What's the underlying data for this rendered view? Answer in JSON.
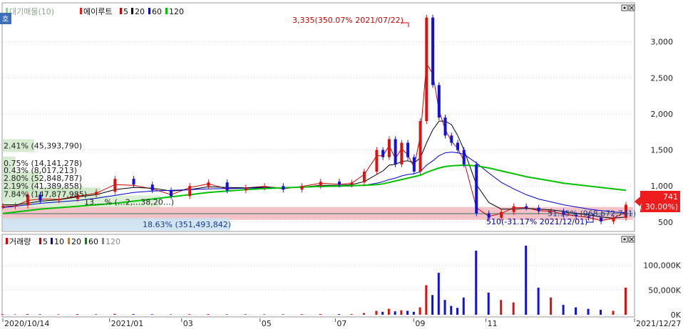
{
  "chart_data": [
    {
      "type": "candlestick",
      "legend": [
        {
          "label": "대기매물(10)",
          "color": "#8fd48f"
        },
        {
          "label": "에이루트",
          "color": "#e02020"
        },
        {
          "label": "5",
          "color": "#cc0000"
        },
        {
          "label": "20",
          "color": "#000000"
        },
        {
          "label": "60",
          "color": "#0000cc"
        },
        {
          "label": "120",
          "color": "#00c000"
        }
      ],
      "y_ticks": [
        "500",
        "1,000",
        "1,500",
        "2,000",
        "2,500",
        "3,000"
      ],
      "y_tick_values": [
        500,
        1000,
        1500,
        2000,
        2500,
        3000
      ],
      "ylim": [
        400,
        3500
      ],
      "x_ticks": [
        "2020/10/14",
        "2021/01",
        "03",
        "05",
        "07",
        "09",
        "11",
        "2021/12/27"
      ],
      "high_annotation": "3,335(350.07% 2021/07/22)",
      "low_annotation": "510(-31.17% 2021/12/01)",
      "current_price": "741",
      "current_change": "( 30.00%)",
      "volume_profile": [
        {
          "label": "2.41% (45,393,790)",
          "price": 1560
        },
        {
          "label": "0.75% (14,141,278)",
          "price": 1320
        },
        {
          "label": "0.43% (8,017,213)",
          "price": 1220
        },
        {
          "label": "2.80% (52,848,787)",
          "price": 1110
        },
        {
          "label": "2.19% (41,389,858)",
          "price": 1000
        },
        {
          "label": "7.84% (147,877,985)",
          "price": 890
        },
        {
          "label": "13.…% (…2,…38,20…)",
          "price": 780
        },
        {
          "label": "51.35% (968,672,741)",
          "price": 620
        },
        {
          "label": "18.63% (351,493,842)",
          "price": 470
        }
      ],
      "series": [
        {
          "name": "price",
          "x": [
            0.0,
            0.02,
            0.04,
            0.06,
            0.09,
            0.12,
            0.15,
            0.18,
            0.21,
            0.24,
            0.27,
            0.3,
            0.33,
            0.36,
            0.39,
            0.42,
            0.45,
            0.48,
            0.51,
            0.54,
            0.56,
            0.58,
            0.6,
            0.61,
            0.62,
            0.63,
            0.64,
            0.65,
            0.66,
            0.67,
            0.68,
            0.69,
            0.7,
            0.71,
            0.72,
            0.73,
            0.74,
            0.76,
            0.78,
            0.8,
            0.82,
            0.84,
            0.86,
            0.88,
            0.9,
            0.92,
            0.94,
            0.96,
            0.98,
            1.0
          ],
          "values": [
            720,
            730,
            880,
            800,
            820,
            880,
            920,
            1100,
            1020,
            940,
            860,
            1000,
            1050,
            940,
            980,
            1000,
            950,
            1000,
            1060,
            1020,
            1050,
            1200,
            1500,
            1400,
            1650,
            1300,
            1600,
            1400,
            1200,
            1900,
            3335,
            2400,
            1950,
            1700,
            1600,
            1500,
            1300,
            620,
            560,
            640,
            720,
            700,
            650,
            650,
            600,
            580,
            560,
            510,
            560,
            741
          ]
        },
        {
          "name": "5",
          "color": "#cc0000",
          "values": [
            720,
            725,
            800,
            820,
            815,
            860,
            900,
            1020,
            1010,
            960,
            880,
            980,
            1030,
            960,
            975,
            995,
            960,
            995,
            1040,
            1025,
            1040,
            1160,
            1420,
            1420,
            1560,
            1380,
            1520,
            1430,
            1260,
            1700,
            2700,
            2550,
            2050,
            1780,
            1620,
            1520,
            1350,
            700,
            580,
            620,
            700,
            700,
            660,
            650,
            610,
            585,
            565,
            520,
            555,
            640
          ]
        },
        {
          "name": "20",
          "color": "#000000",
          "values": [
            740,
            740,
            760,
            790,
            810,
            850,
            880,
            950,
            980,
            970,
            930,
            950,
            990,
            980,
            975,
            985,
            975,
            985,
            1010,
            1010,
            1020,
            1060,
            1160,
            1210,
            1290,
            1300,
            1340,
            1350,
            1320,
            1390,
            1600,
            1780,
            1900,
            1900,
            1850,
            1700,
            1500,
            1020,
            770,
            680,
            680,
            690,
            680,
            670,
            650,
            620,
            600,
            570,
            555,
            570
          ]
        },
        {
          "name": "60",
          "color": "#0000cc",
          "values": [
            700,
            720,
            740,
            760,
            780,
            800,
            830,
            870,
            910,
            930,
            940,
            950,
            960,
            965,
            970,
            975,
            978,
            982,
            990,
            995,
            1000,
            1010,
            1040,
            1060,
            1090,
            1110,
            1140,
            1160,
            1170,
            1200,
            1290,
            1350,
            1420,
            1460,
            1470,
            1460,
            1440,
            1320,
            1180,
            1050,
            960,
            880,
            820,
            780,
            740,
            710,
            680,
            660,
            640,
            630
          ]
        },
        {
          "name": "120",
          "color": "#00c000",
          "values": [
            620,
            640,
            660,
            680,
            700,
            720,
            740,
            760,
            790,
            820,
            850,
            880,
            910,
            930,
            950,
            965,
            975,
            985,
            995,
            1000,
            1005,
            1010,
            1020,
            1030,
            1050,
            1070,
            1090,
            1110,
            1130,
            1150,
            1190,
            1220,
            1250,
            1270,
            1280,
            1285,
            1290,
            1280,
            1250,
            1210,
            1170,
            1130,
            1100,
            1070,
            1040,
            1020,
            1000,
            980,
            960,
            940
          ]
        }
      ]
    },
    {
      "type": "bar",
      "legend": [
        {
          "label": "거래량",
          "color": "#dd0000"
        },
        {
          "label": "5",
          "color": "#cc0000"
        },
        {
          "label": "10",
          "color": "#0000cc"
        },
        {
          "label": "20",
          "color": "#dd7700"
        },
        {
          "label": "60",
          "color": "#008800"
        },
        {
          "label": "120",
          "color": "#888888"
        }
      ],
      "y_ticks": [
        "0K",
        "50,000K",
        "100,000K"
      ],
      "y_tick_values": [
        0,
        50000,
        100000
      ],
      "ylim": [
        0,
        140000
      ],
      "values_k": [
        1200,
        800,
        1500,
        1000,
        900,
        1300,
        1100,
        2000,
        1400,
        1000,
        800,
        1200,
        1300,
        900,
        1100,
        1000,
        900,
        1200,
        1500,
        1300,
        1400,
        3500,
        8000,
        6000,
        12000,
        7000,
        9000,
        8000,
        6000,
        15000,
        60000,
        40000,
        85000,
        30000,
        18000,
        14000,
        35000,
        130000,
        45000,
        30000,
        25000,
        140000,
        55000,
        35000,
        20000,
        15000,
        12000,
        10000,
        8000,
        55000
      ]
    }
  ],
  "corner_buttons": [
    "▣",
    "✕"
  ],
  "side_label": "호"
}
